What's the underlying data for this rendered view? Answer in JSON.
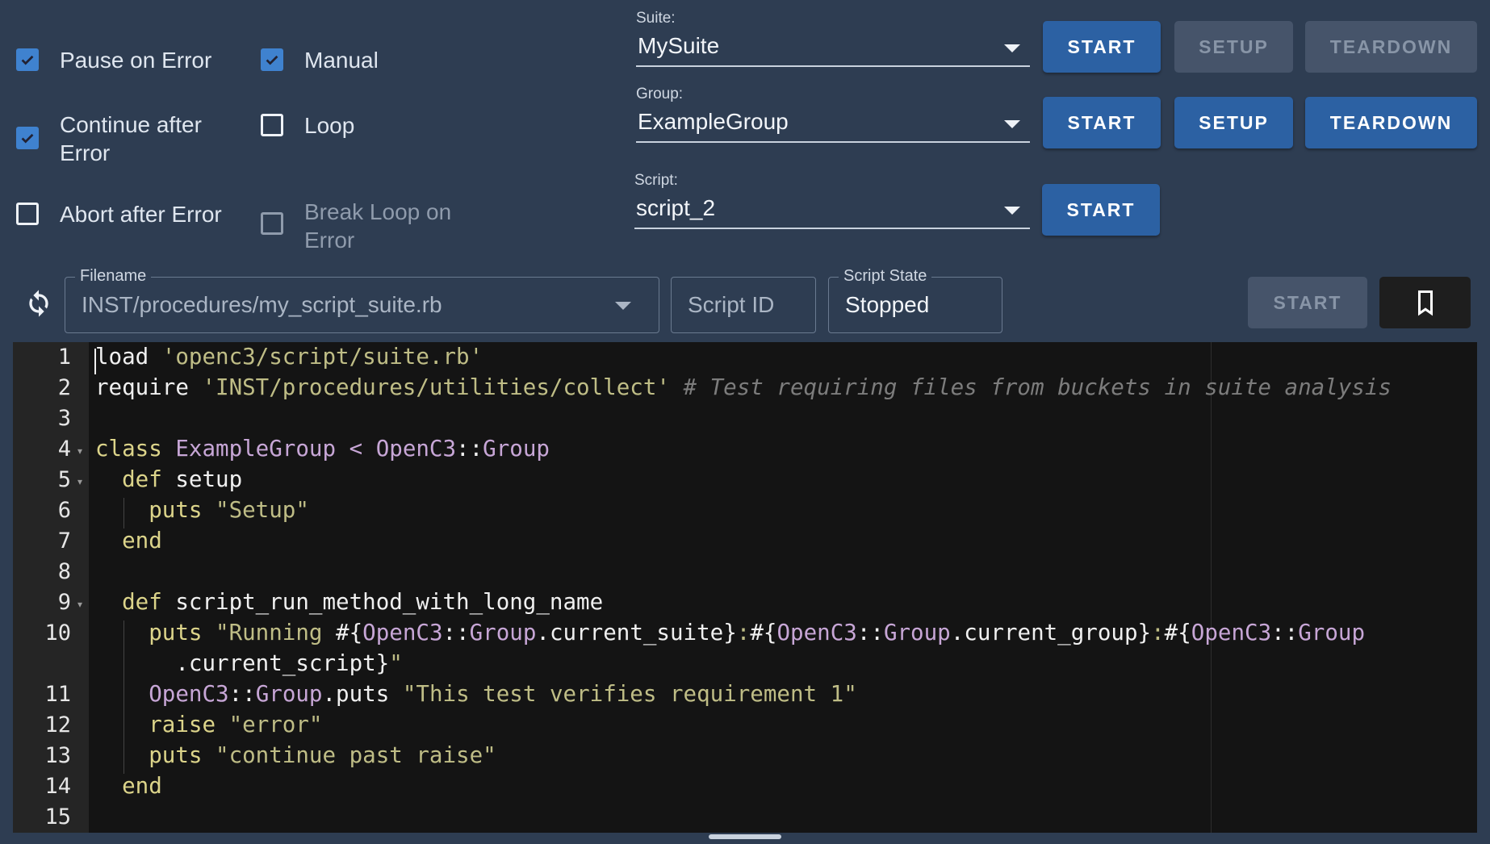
{
  "options": {
    "pause_on_error": {
      "label": "Pause on Error",
      "checked": true
    },
    "manual": {
      "label": "Manual",
      "checked": true
    },
    "continue_after_error": {
      "label": "Continue after Error",
      "checked": true
    },
    "loop": {
      "label": "Loop",
      "checked": false
    },
    "abort_after_error": {
      "label": "Abort after Error",
      "checked": false
    },
    "break_loop_on_error": {
      "label": "Break Loop on Error",
      "checked": false,
      "disabled": true
    }
  },
  "suite": {
    "label": "Suite:",
    "value": "MySuite",
    "buttons": {
      "start": "START",
      "setup": "SETUP",
      "teardown": "TEARDOWN"
    }
  },
  "group": {
    "label": "Group:",
    "value": "ExampleGroup",
    "buttons": {
      "start": "START",
      "setup": "SETUP",
      "teardown": "TEARDOWN"
    }
  },
  "script": {
    "label": "Script:",
    "value": "script_2",
    "buttons": {
      "start": "START"
    }
  },
  "toolbar": {
    "reload_icon": "reload-icon",
    "filename_label": "Filename",
    "filename_value": "INST/procedures/my_script_suite.rb",
    "script_id_placeholder": "Script ID",
    "script_state_label": "Script State",
    "script_state_value": "Stopped",
    "start_label": "START",
    "bookmark_icon": "bookmark-icon"
  },
  "editor": {
    "line_numbers": [
      "1",
      "2",
      "3",
      "4",
      "5",
      "6",
      "7",
      "8",
      "9",
      "10",
      "11",
      "12",
      "13",
      "14",
      "15"
    ],
    "lines": [
      "load 'openc3/script/suite.rb'",
      "require 'INST/procedures/utilities/collect' # Test requiring files from buckets in suite analysis",
      "",
      "class ExampleGroup < OpenC3::Group",
      "  def setup",
      "    puts \"Setup\"",
      "  end",
      "",
      "  def script_run_method_with_long_name",
      "    puts \"Running #{OpenC3::Group.current_suite}:#{OpenC3::Group.current_group}:#{OpenC3::Group",
      "      .current_script}\"",
      "    OpenC3::Group.puts \"This test verifies requirement 1\"",
      "    raise \"error\"",
      "    puts \"continue past raise\"",
      "  end",
      ""
    ]
  },
  "colors": {
    "background": "#2e3d52",
    "primary_button": "#2c61a3",
    "checkbox_checked": "#3f82cf",
    "editor_bg": "#141414",
    "gutter_bg": "#252525"
  }
}
